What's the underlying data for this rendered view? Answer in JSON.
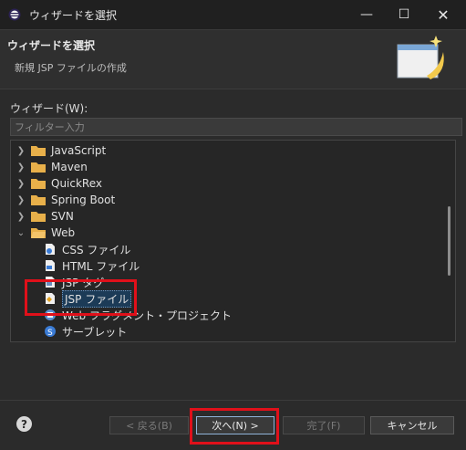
{
  "window": {
    "title": "ウィザードを選択",
    "minimize": "—",
    "maximize": "☐",
    "close": "✕"
  },
  "header": {
    "title": "ウィザードを選択",
    "subtitle": "新規 JSP ファイルの作成"
  },
  "wizard_label": "ウィザード(W):",
  "filter": {
    "placeholder": "フィルター入力",
    "value": ""
  },
  "tree": {
    "items": [
      {
        "label": "JavaScript",
        "type": "folder",
        "expanded": false
      },
      {
        "label": "Maven",
        "type": "folder",
        "expanded": false
      },
      {
        "label": "QuickRex",
        "type": "folder",
        "expanded": false
      },
      {
        "label": "Spring Boot",
        "type": "folder",
        "expanded": false
      },
      {
        "label": "SVN",
        "type": "folder",
        "expanded": false
      },
      {
        "label": "Web",
        "type": "folder",
        "expanded": true
      },
      {
        "label": "CSS ファイル",
        "type": "file"
      },
      {
        "label": "HTML ファイル",
        "type": "file"
      },
      {
        "label": "JSP タグ",
        "type": "file"
      },
      {
        "label": "JSP ファイル",
        "type": "file",
        "selected": true
      },
      {
        "label": "Web フラグメント・プロジェクト",
        "type": "file"
      },
      {
        "label": "サーブレット",
        "type": "file"
      }
    ]
  },
  "buttons": {
    "help": "?",
    "back": "< 戻る(B)",
    "next": "次へ(N) >",
    "finish": "完了(F)",
    "cancel": "キャンセル"
  },
  "colors": {
    "highlight": "#e0101a",
    "folder": "#e8b04a",
    "background": "#2b2b2b"
  }
}
